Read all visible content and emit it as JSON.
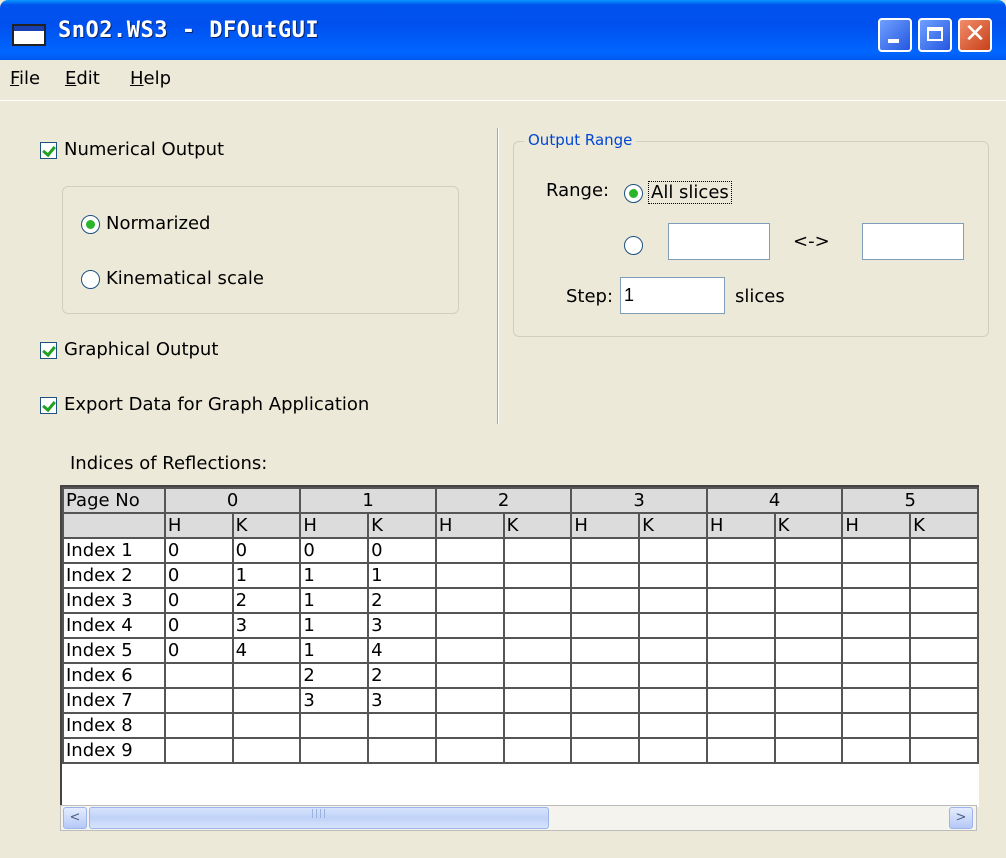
{
  "window": {
    "title": "SnO2.WS3 - DFOutGUI"
  },
  "menu": [
    {
      "mnemonic": "F",
      "rest": "ile"
    },
    {
      "mnemonic": "E",
      "rest": "dit"
    },
    {
      "mnemonic": "H",
      "rest": "elp"
    }
  ],
  "numerical_output": {
    "label": "Numerical Output",
    "checked": true,
    "normalized_label": "Normarized",
    "kinematical_label": "Kinematical scale",
    "selected": "Normarized"
  },
  "graphical_output": {
    "label": "Graphical Output",
    "checked": true
  },
  "export_data": {
    "label": "Export Data for Graph Application",
    "checked": true
  },
  "output_range": {
    "legend": "Output Range",
    "range_label": "Range:",
    "all_slices_label": "All slices",
    "selected": "All slices",
    "from_value": "",
    "separator": "<->",
    "to_value": "",
    "step_label": "Step:",
    "step_value": "1",
    "slices_unit": "slices"
  },
  "reflections": {
    "label": "Indices of Reflections:",
    "corner_label": "Page No",
    "pages": [
      "0",
      "1",
      "2",
      "3",
      "4",
      "5"
    ],
    "sub_headers": [
      "H",
      "K"
    ],
    "rows": [
      {
        "label": "Index 1",
        "cells": [
          "0",
          "0",
          "0",
          "0",
          "",
          "",
          "",
          "",
          "",
          "",
          "",
          ""
        ]
      },
      {
        "label": "Index 2",
        "cells": [
          "0",
          "1",
          "1",
          "1",
          "",
          "",
          "",
          "",
          "",
          "",
          "",
          ""
        ]
      },
      {
        "label": "Index 3",
        "cells": [
          "0",
          "2",
          "1",
          "2",
          "",
          "",
          "",
          "",
          "",
          "",
          "",
          ""
        ]
      },
      {
        "label": "Index 4",
        "cells": [
          "0",
          "3",
          "1",
          "3",
          "",
          "",
          "",
          "",
          "",
          "",
          "",
          ""
        ]
      },
      {
        "label": "Index 5",
        "cells": [
          "0",
          "4",
          "1",
          "4",
          "",
          "",
          "",
          "",
          "",
          "",
          "",
          ""
        ]
      },
      {
        "label": "Index 6",
        "cells": [
          "",
          "",
          "2",
          "2",
          "",
          "",
          "",
          "",
          "",
          "",
          "",
          ""
        ]
      },
      {
        "label": "Index 7",
        "cells": [
          "",
          "",
          "3",
          "3",
          "",
          "",
          "",
          "",
          "",
          "",
          "",
          ""
        ]
      },
      {
        "label": "Index 8",
        "cells": [
          "",
          "",
          "",
          "",
          "",
          "",
          "",
          "",
          "",
          "",
          "",
          ""
        ]
      },
      {
        "label": "Index 9",
        "cells": [
          "",
          "",
          "",
          "",
          "",
          "",
          "",
          "",
          "",
          "",
          "",
          ""
        ]
      }
    ]
  },
  "scrollbar": {
    "left_arrow": "<",
    "right_arrow": ">"
  }
}
